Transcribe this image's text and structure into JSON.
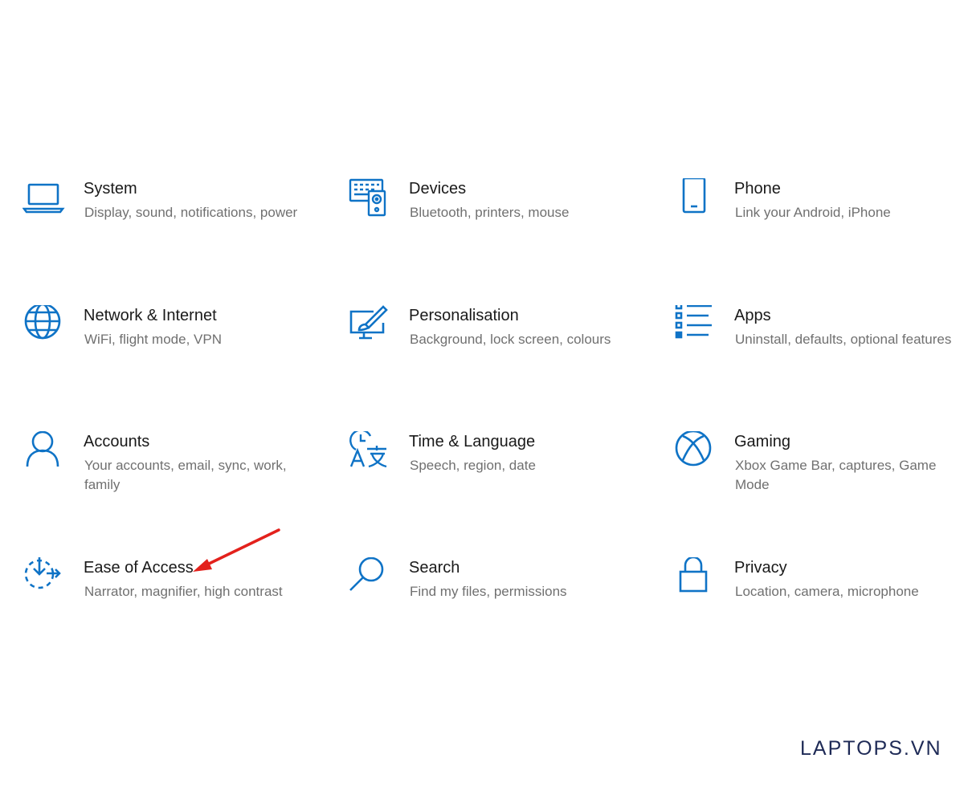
{
  "accent_color": "#0f73c6",
  "arrow_color": "#e3211c",
  "tiles": [
    {
      "title": "System",
      "desc": "Display, sound, notifications, power",
      "icon": "laptop-icon"
    },
    {
      "title": "Devices",
      "desc": "Bluetooth, printers, mouse",
      "icon": "keyboard-speaker-icon"
    },
    {
      "title": "Phone",
      "desc": "Link your Android, iPhone",
      "icon": "phone-icon"
    },
    {
      "title": "Network & Internet",
      "desc": "WiFi, flight mode, VPN",
      "icon": "globe-icon"
    },
    {
      "title": "Personalisation",
      "desc": "Background, lock screen, colours",
      "icon": "paint-monitor-icon"
    },
    {
      "title": "Apps",
      "desc": "Uninstall, defaults, optional features",
      "icon": "apps-list-icon"
    },
    {
      "title": "Accounts",
      "desc": "Your accounts, email, sync, work, family",
      "icon": "person-icon"
    },
    {
      "title": "Time & Language",
      "desc": "Speech, region, date",
      "icon": "time-language-icon"
    },
    {
      "title": "Gaming",
      "desc": "Xbox Game Bar, captures, Game Mode",
      "icon": "xbox-icon"
    },
    {
      "title": "Ease of Access",
      "desc": "Narrator, magnifier, high contrast",
      "icon": "ease-of-access-icon"
    },
    {
      "title": "Search",
      "desc": "Find my files, permissions",
      "icon": "magnifier-icon"
    },
    {
      "title": "Privacy",
      "desc": "Location, camera, microphone",
      "icon": "padlock-icon"
    }
  ],
  "watermark": "LAPTOPS.VN"
}
